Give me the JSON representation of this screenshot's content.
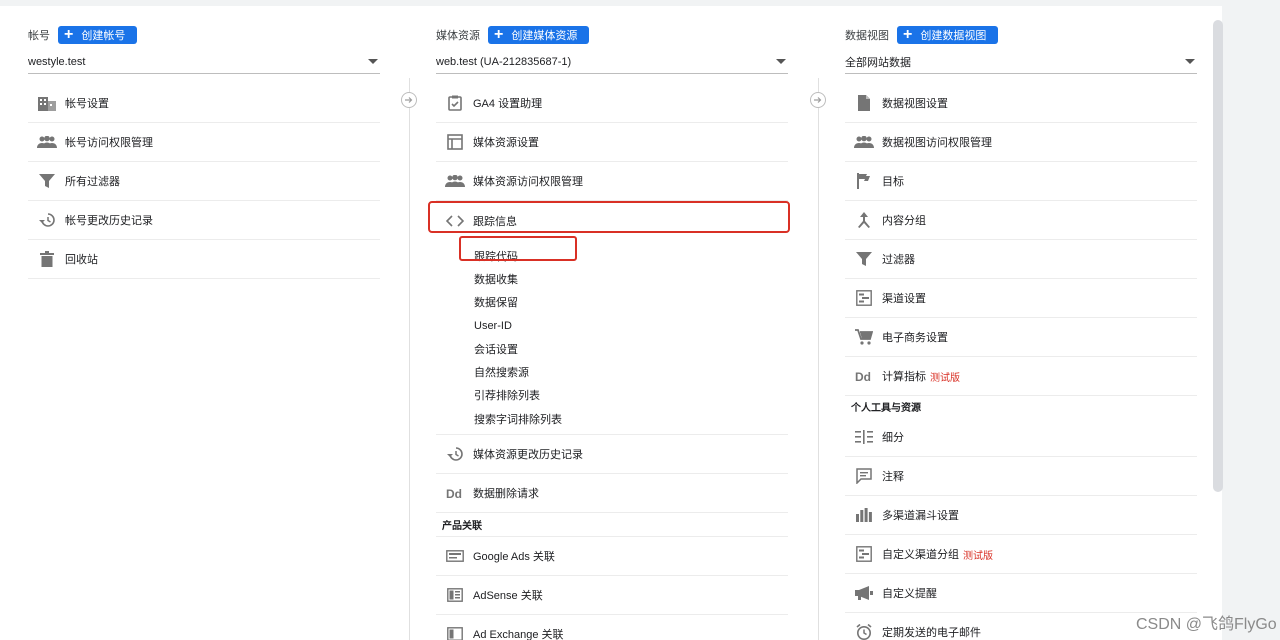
{
  "account": {
    "title": "帐号",
    "create_label": "创建帐号",
    "selected": "westyle.test",
    "items": [
      {
        "label": "帐号设置",
        "icon": "building-icon"
      },
      {
        "label": "帐号访问权限管理",
        "icon": "people-icon"
      },
      {
        "label": "所有过滤器",
        "icon": "filter-icon"
      },
      {
        "label": "帐号更改历史记录",
        "icon": "history-icon"
      },
      {
        "label": "回收站",
        "icon": "trash-icon"
      }
    ]
  },
  "property": {
    "title": "媒体资源",
    "create_label": "创建媒体资源",
    "selected": "web.test (UA-212835687-1)",
    "items": [
      {
        "label": "GA4 设置助理",
        "icon": "clipboard-check-icon"
      },
      {
        "label": "媒体资源设置",
        "icon": "layout-icon"
      },
      {
        "label": "媒体资源访问权限管理",
        "icon": "people-icon"
      },
      {
        "label": "跟踪信息",
        "icon": "code-icon"
      }
    ],
    "tracking_sub": [
      "跟踪代码",
      "数据收集",
      "数据保留",
      "User-ID",
      "会话设置",
      "自然搜索源",
      "引荐排除列表",
      "搜索字词排除列表"
    ],
    "items_after": [
      {
        "label": "媒体资源更改历史记录",
        "icon": "history-icon"
      },
      {
        "label": "数据删除请求",
        "icon": "dd-icon"
      }
    ],
    "section_product": "产品关联",
    "product_links": [
      {
        "label": "Google Ads 关联",
        "icon": "ads-icon"
      },
      {
        "label": "AdSense 关联",
        "icon": "adsense-icon"
      },
      {
        "label": "Ad Exchange 关联",
        "icon": "adexchange-icon"
      }
    ]
  },
  "view": {
    "title": "数据视图",
    "create_label": "创建数据视图",
    "selected": "全部网站数据",
    "items": [
      {
        "label": "数据视图设置",
        "icon": "document-icon",
        "tag": ""
      },
      {
        "label": "数据视图访问权限管理",
        "icon": "people-icon",
        "tag": ""
      },
      {
        "label": "目标",
        "icon": "flag-icon",
        "tag": ""
      },
      {
        "label": "内容分组",
        "icon": "content-group-icon",
        "tag": ""
      },
      {
        "label": "过滤器",
        "icon": "filter-icon",
        "tag": ""
      },
      {
        "label": "渠道设置",
        "icon": "channel-icon",
        "tag": ""
      },
      {
        "label": "电子商务设置",
        "icon": "cart-icon",
        "tag": ""
      },
      {
        "label": "计算指标",
        "icon": "dd-icon",
        "tag": "测试版"
      }
    ],
    "section_personal": "个人工具与资源",
    "personal_items": [
      {
        "label": "细分",
        "icon": "segments-icon",
        "tag": ""
      },
      {
        "label": "注释",
        "icon": "comment-icon",
        "tag": ""
      },
      {
        "label": "多渠道漏斗设置",
        "icon": "bar-chart-icon",
        "tag": ""
      },
      {
        "label": "自定义渠道分组",
        "icon": "channel-icon",
        "tag": "测试版"
      },
      {
        "label": "自定义提醒",
        "icon": "megaphone-icon",
        "tag": ""
      },
      {
        "label": "定期发送的电子邮件",
        "icon": "clock-icon",
        "tag": ""
      }
    ]
  },
  "watermark": "CSDN @飞鸽FlyGo"
}
